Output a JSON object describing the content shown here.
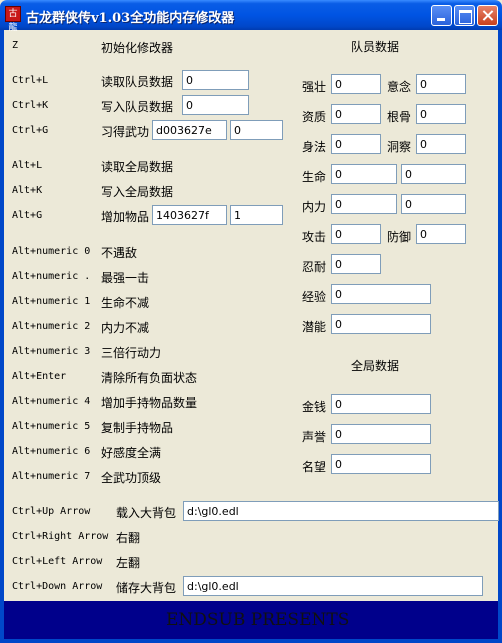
{
  "window": {
    "title": "古龙群侠传v1.03全功能内存修改器",
    "icon_text": "古龍"
  },
  "hotkeys": [
    {
      "key": "Z",
      "label": "初始化修改器"
    },
    {
      "key": "Ctrl+L",
      "label": "读取队员数据",
      "value": "0"
    },
    {
      "key": "Ctrl+K",
      "label": "写入队员数据",
      "value": "0"
    },
    {
      "key": "Ctrl+G",
      "label": "习得武功",
      "value": "d003627e",
      "value2": "0"
    },
    {
      "key": "Alt+L",
      "label": "读取全局数据"
    },
    {
      "key": "Alt+K",
      "label": "写入全局数据"
    },
    {
      "key": "Alt+G",
      "label": "增加物品",
      "value": "1403627f",
      "value2": "1"
    },
    {
      "key": "Alt+numeric 0",
      "label": "不遇敌"
    },
    {
      "key": "Alt+numeric .",
      "label": "最强一击"
    },
    {
      "key": "Alt+numeric 1",
      "label": "生命不减"
    },
    {
      "key": "Alt+numeric 2",
      "label": "内力不减"
    },
    {
      "key": "Alt+numeric 3",
      "label": "三倍行动力"
    },
    {
      "key": "Alt+Enter",
      "label": "清除所有负面状态"
    },
    {
      "key": "Alt+numeric 4",
      "label": "增加手持物品数量"
    },
    {
      "key": "Alt+numeric 5",
      "label": "复制手持物品"
    },
    {
      "key": "Alt+numeric 6",
      "label": "好感度全满"
    },
    {
      "key": "Alt+numeric 7",
      "label": "全武功顶级"
    },
    {
      "key": "Ctrl+Up Arrow",
      "label": "载入大背包",
      "value": "d:\\gl0.edl"
    },
    {
      "key": "Ctrl+Right Arrow",
      "label": "右翻"
    },
    {
      "key": "Ctrl+Left Arrow",
      "label": "左翻"
    },
    {
      "key": "Ctrl+Down Arrow",
      "label": "储存大背包",
      "value": "d:\\gl0.edl"
    }
  ],
  "member": {
    "heading": "队员数据",
    "strength": {
      "label": "强壮",
      "value": "0"
    },
    "will": {
      "label": "意念",
      "value": "0"
    },
    "aptitude": {
      "label": "资质",
      "value": "0"
    },
    "root": {
      "label": "根骨",
      "value": "0"
    },
    "agility": {
      "label": "身法",
      "value": "0"
    },
    "insight": {
      "label": "洞察",
      "value": "0"
    },
    "life": {
      "label": "生命",
      "value": "0",
      "value2": "0"
    },
    "inner": {
      "label": "内力",
      "value": "0",
      "value2": "0"
    },
    "attack": {
      "label": "攻击",
      "value": "0"
    },
    "defense": {
      "label": "防御",
      "value": "0"
    },
    "endurance": {
      "label": "忍耐",
      "value": "0"
    },
    "exp": {
      "label": "经验",
      "value": "0"
    },
    "potential": {
      "label": "潜能",
      "value": "0"
    }
  },
  "global": {
    "heading": "全局数据",
    "money": {
      "label": "金钱",
      "value": "0"
    },
    "reputation": {
      "label": "声誉",
      "value": "0"
    },
    "fame": {
      "label": "名望",
      "value": "0"
    }
  },
  "footer": {
    "text": "ENDSUB PRESENTS"
  },
  "colors": {
    "title_bar": "#0054e3",
    "window_bg": "#ece9d8",
    "footer_bg": "#00008b"
  }
}
